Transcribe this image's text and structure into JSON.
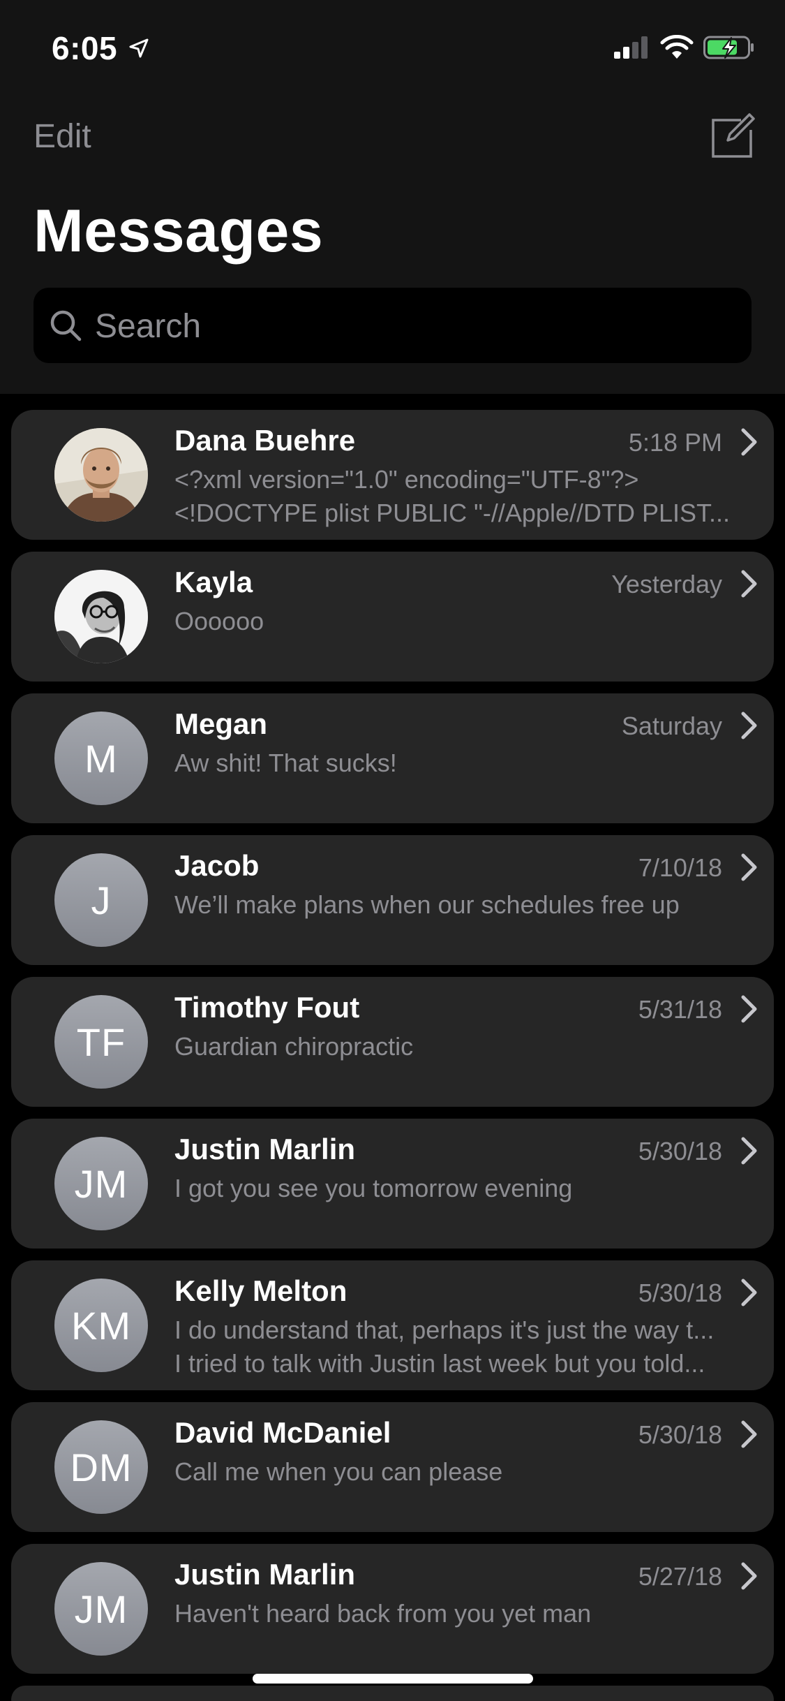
{
  "status_bar": {
    "time": "6:05"
  },
  "nav": {
    "edit_label": "Edit",
    "title": "Messages"
  },
  "search": {
    "placeholder": "Search"
  },
  "conversations": [
    {
      "name": "Dana Buehre",
      "time": "5:18 PM",
      "preview": [
        "<?xml version=\"1.0\" encoding=\"UTF-8\"?>",
        "<!DOCTYPE plist PUBLIC \"-//Apple//DTD PLIST..."
      ],
      "avatar": "photo"
    },
    {
      "name": "Kayla",
      "time": "Yesterday",
      "preview": [
        "Oooooo"
      ],
      "avatar": "photo"
    },
    {
      "name": "Megan",
      "time": "Saturday",
      "preview": [
        "Aw shit! That sucks!"
      ],
      "initials": "M"
    },
    {
      "name": "Jacob",
      "time": "7/10/18",
      "preview": [
        "We’ll make plans when our schedules free up"
      ],
      "initials": "J"
    },
    {
      "name": "Timothy Fout",
      "time": "5/31/18",
      "preview": [
        "Guardian chiropractic"
      ],
      "initials": "TF"
    },
    {
      "name": "Justin Marlin",
      "time": "5/30/18",
      "preview": [
        "I got you see you tomorrow evening"
      ],
      "initials": "JM"
    },
    {
      "name": "Kelly Melton",
      "time": "5/30/18",
      "preview": [
        "I do understand that, perhaps it's just the way t...",
        "I tried to talk with Justin last week but you told..."
      ],
      "initials": "KM"
    },
    {
      "name": "David McDaniel",
      "time": "5/30/18",
      "preview": [
        "Call me when you can please"
      ],
      "initials": "DM"
    },
    {
      "name": "Justin Marlin",
      "time": "5/27/18",
      "preview": [
        "Haven't heard back from you yet man"
      ],
      "initials": "JM"
    }
  ],
  "colors": {
    "background": "#000000",
    "header": "#141414",
    "row": "#262626",
    "secondary_text": "#8e8e93",
    "battery": "#4cd964"
  }
}
